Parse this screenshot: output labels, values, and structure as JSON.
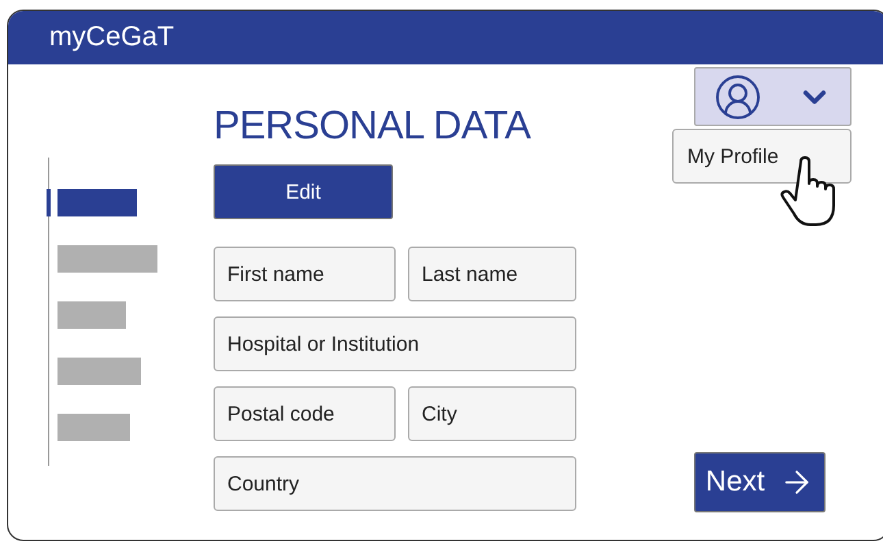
{
  "app": {
    "title": "myCeGaT"
  },
  "profile_menu": {
    "expanded": true,
    "items": [
      {
        "label": "My Profile"
      }
    ]
  },
  "sidebar": {
    "items": [
      {
        "selected": true
      },
      {
        "selected": false
      },
      {
        "selected": false
      },
      {
        "selected": false
      },
      {
        "selected": false
      }
    ]
  },
  "page": {
    "title": "PERSONAL DATA",
    "edit_button": "Edit"
  },
  "form": {
    "rows": [
      [
        {
          "placeholder": "First name"
        },
        {
          "placeholder": "Last name"
        }
      ],
      [
        {
          "placeholder": "Hospital or Institution"
        }
      ],
      [
        {
          "placeholder": "Postal code"
        },
        {
          "placeholder": "City"
        }
      ],
      [
        {
          "placeholder": "Country"
        }
      ]
    ]
  },
  "next_button": "Next"
}
